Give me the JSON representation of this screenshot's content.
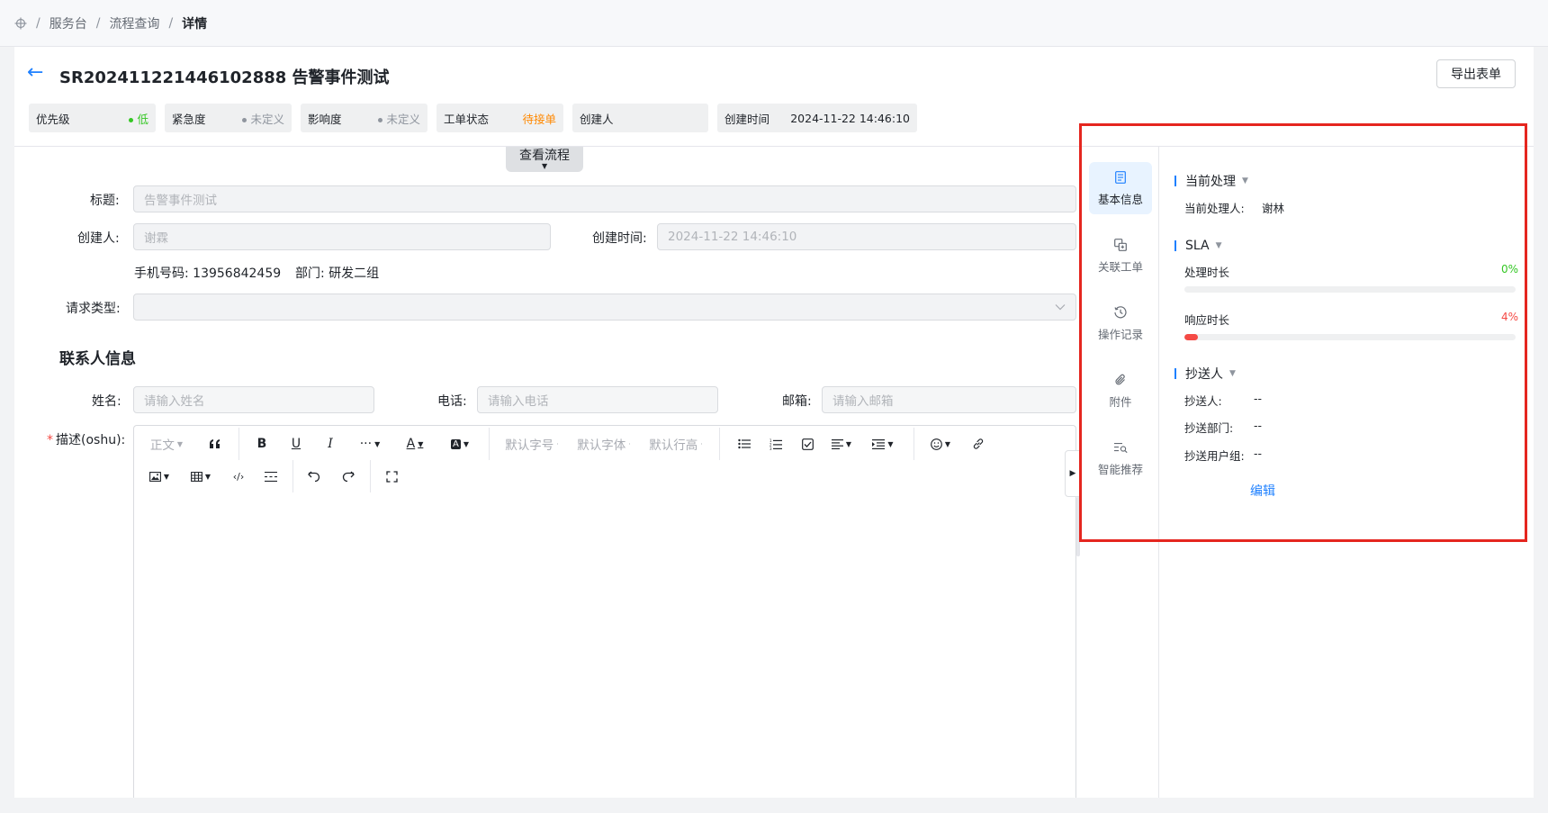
{
  "breadcrumb": {
    "items": [
      "服务台",
      "流程查询",
      "详情"
    ]
  },
  "header": {
    "title": "SR202411221446102888 告警事件测试",
    "export_label": "导出表单",
    "chips": [
      {
        "label": "优先级",
        "value": "低",
        "color": "#34c724"
      },
      {
        "label": "紧急度",
        "value": "未定义",
        "color": "#8f959e"
      },
      {
        "label": "影响度",
        "value": "未定义",
        "color": "#8f959e"
      },
      {
        "label": "工单状态",
        "value": "待接单",
        "color": "#ff8800"
      },
      {
        "label": "创建人",
        "value": ""
      },
      {
        "label": "创建时间",
        "value": "2024-11-22 14:46:10"
      }
    ]
  },
  "flow_button": "查看流程",
  "form": {
    "title_label": "标题:",
    "title_value": "告警事件测试",
    "creator_label": "创建人:",
    "creator_value": "谢霖",
    "created_time_label": "创建时间:",
    "created_time_value": "2024-11-22 14:46:10",
    "phone_label": "手机号码:",
    "phone_value": "13956842459",
    "dept_label": "部门:",
    "dept_value": "研发二组",
    "request_type_label": "请求类型:",
    "contact_section": "联系人信息",
    "name_label": "姓名:",
    "name_placeholder": "请输入姓名",
    "tel_label": "电话:",
    "tel_placeholder": "请输入电话",
    "email_label": "邮箱:",
    "email_placeholder": "请输入邮箱",
    "desc_required": "*",
    "desc_label": "描述(oshu):"
  },
  "editor_toolbar": {
    "paragraph": "正文",
    "font_size": "默认字号",
    "font_family": "默认字体",
    "line_height": "默认行高",
    "text_color": "A",
    "bg_color": "A",
    "more": "···",
    "bold": "B",
    "underline": "U",
    "italic": "I"
  },
  "side_tabs": [
    {
      "label": "基本信息",
      "icon": "document-icon",
      "active": true
    },
    {
      "label": "关联工单",
      "icon": "link-tickets-icon",
      "active": false
    },
    {
      "label": "操作记录",
      "icon": "history-icon",
      "active": false
    },
    {
      "label": "附件",
      "icon": "paperclip-icon",
      "active": false
    },
    {
      "label": "智能推荐",
      "icon": "smart-search-icon",
      "active": false
    }
  ],
  "panel": {
    "current": {
      "heading": "当前处理",
      "handler_label": "当前处理人:",
      "handler_value": "谢林"
    },
    "sla": {
      "heading": "SLA",
      "process_label": "处理时长",
      "process_pct": "0%",
      "process_fraction": 0.0,
      "response_label": "响应时长",
      "response_pct": "4%",
      "response_fraction": 0.04,
      "ok_color": "#34c724",
      "alert_color": "#f54a45"
    },
    "cc": {
      "heading": "抄送人",
      "cc_person_label": "抄送人:",
      "cc_person_value": "--",
      "cc_dept_label": "抄送部门:",
      "cc_dept_value": "--",
      "cc_group_label": "抄送用户组:",
      "cc_group_value": "--",
      "edit_label": "编辑"
    }
  },
  "colors": {
    "accent": "#1e80ff",
    "highlight": "#e5261f"
  }
}
